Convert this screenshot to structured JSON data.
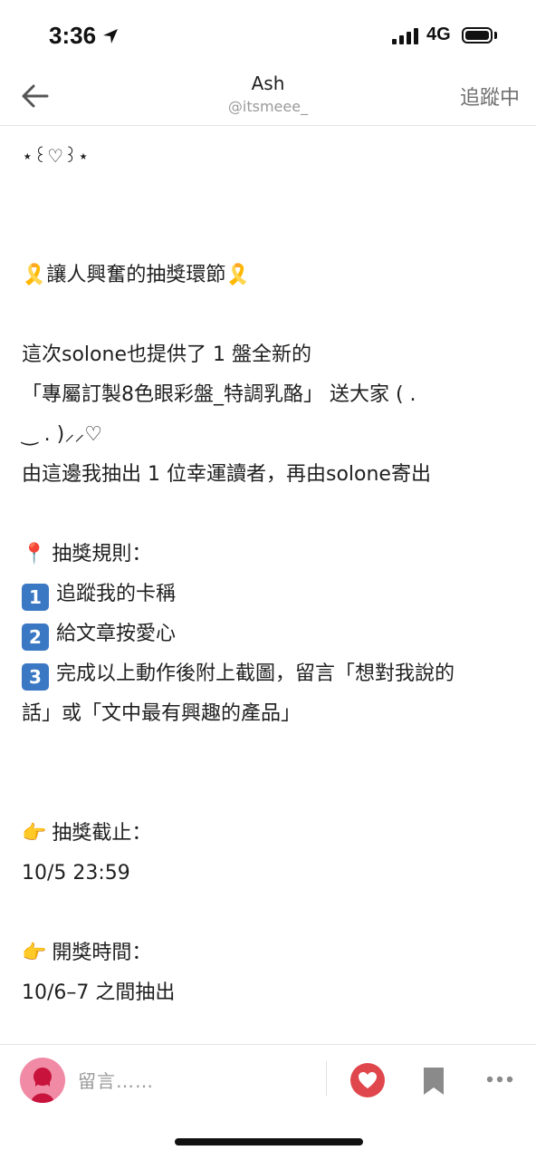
{
  "status_bar": {
    "time": "3:36",
    "network": "4G"
  },
  "nav": {
    "author_name": "Ash",
    "author_handle": "@itsmeee_",
    "follow_label": "追蹤中"
  },
  "post": {
    "lines": [
      "⋆꒰♡꒱⋆",
      "🎗️讓人興奮的抽獎環節🎗️",
      "這次solone也提供了 1 盤全新的",
      "「專屬訂製8色眼彩盤_特調乳酪」 送大家 ( .",
      "‿ . )⸝⸝♡",
      "由這邊我抽出 1 位幸運讀者，再由solone寄出",
      "抽獎規則：",
      "追蹤我的卡稱",
      "給文章按愛心",
      "完成以上動作後附上截圖，留言「想對我說的",
      "話」或「文中最有興趣的產品」",
      "抽獎截止：",
      "10/5 23:59",
      "開獎時間：",
      "10/6–7 之間抽出"
    ],
    "rule_numbers": [
      "1",
      "2",
      "3"
    ]
  },
  "bottom_bar": {
    "comment_placeholder": "留言……"
  },
  "colors": {
    "accent_red": "#e0474c",
    "badge_blue": "#3b78c4",
    "avatar_pink": "#f08aa5"
  }
}
